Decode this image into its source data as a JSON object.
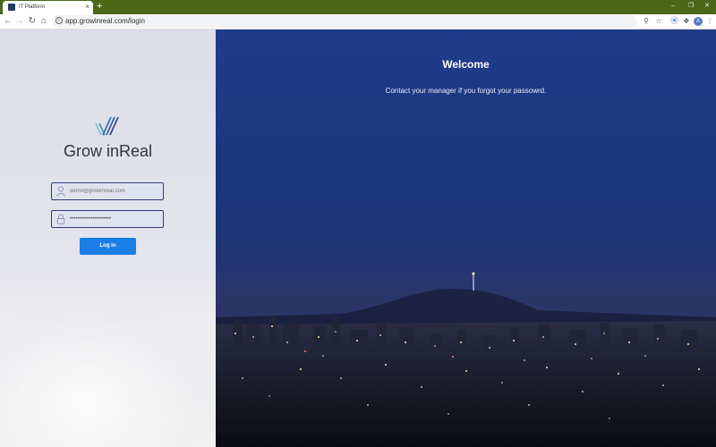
{
  "browser": {
    "tab_title": "IT Platform",
    "tab_close": "×",
    "new_tab": "+",
    "url": "app.growinreal.com/login",
    "window_controls": [
      "–",
      "❐",
      "✕"
    ],
    "profile_initial": "A",
    "toolbar_icons": [
      "key-icon",
      "star-icon",
      "extension-icon",
      "puzzle-icon",
      "profile-avatar",
      "menu-icon"
    ]
  },
  "login": {
    "brand": "Grow inReal",
    "email_placeholder": "demo@growinreal.com",
    "password_value": "••••••••••••••••••••••",
    "login_label": "Log in"
  },
  "hero": {
    "title": "Welcome",
    "subtitle": "Contact your manager if you forgot your passowrd."
  },
  "colors": {
    "tabbar": "#4a6818",
    "accent_button": "#1a7ee6",
    "field_border": "#2f3c7a",
    "sky": "#1f3b8a"
  }
}
